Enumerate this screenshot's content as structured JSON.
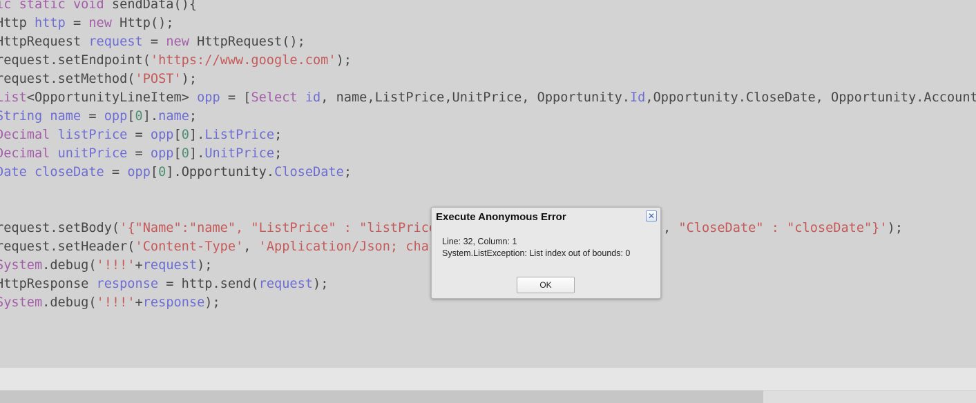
{
  "code_lines": [
    [
      [
        "kw",
        "ic static void"
      ],
      [
        "pl",
        " sendData(){"
      ]
    ],
    [
      [
        "pl",
        "Http "
      ],
      [
        "var",
        "http"
      ],
      [
        "pl",
        " = "
      ],
      [
        "kw",
        "new"
      ],
      [
        "pl",
        " Http();"
      ]
    ],
    [
      [
        "pl",
        "HttpRequest "
      ],
      [
        "var",
        "request"
      ],
      [
        "pl",
        " = "
      ],
      [
        "kw",
        "new"
      ],
      [
        "pl",
        " HttpRequest();"
      ]
    ],
    [
      [
        "pl",
        "request.setEndpoint("
      ],
      [
        "str",
        "'https://www.google.com'"
      ],
      [
        "pl",
        ");"
      ]
    ],
    [
      [
        "pl",
        "request.setMethod("
      ],
      [
        "str",
        "'POST'"
      ],
      [
        "pl",
        ");"
      ]
    ],
    [
      [
        "kw",
        "List"
      ],
      [
        "pl",
        "<OpportunityLineItem> "
      ],
      [
        "var",
        "opp"
      ],
      [
        "pl",
        " = ["
      ],
      [
        "kw",
        "Select"
      ],
      [
        "pl",
        " "
      ],
      [
        "var",
        "id"
      ],
      [
        "pl",
        ", name,ListPrice,UnitPrice, Opportunity."
      ],
      [
        "var",
        "Id"
      ],
      [
        "pl",
        ",Opportunity.CloseDate, Opportunity.Account"
      ]
    ],
    [
      [
        "var",
        "String name"
      ],
      [
        "pl",
        " = "
      ],
      [
        "var",
        "opp"
      ],
      [
        "pl",
        "["
      ],
      [
        "num",
        "0"
      ],
      [
        "pl",
        "]."
      ],
      [
        "var",
        "name"
      ],
      [
        "pl",
        ";"
      ]
    ],
    [
      [
        "kw",
        "Decimal"
      ],
      [
        "pl",
        " "
      ],
      [
        "var",
        "listPrice"
      ],
      [
        "pl",
        " = "
      ],
      [
        "var",
        "opp"
      ],
      [
        "pl",
        "["
      ],
      [
        "num",
        "0"
      ],
      [
        "pl",
        "]."
      ],
      [
        "var",
        "ListPrice"
      ],
      [
        "pl",
        ";"
      ]
    ],
    [
      [
        "kw",
        "Decimal"
      ],
      [
        "pl",
        " "
      ],
      [
        "var",
        "unitPrice"
      ],
      [
        "pl",
        " = "
      ],
      [
        "var",
        "opp"
      ],
      [
        "pl",
        "["
      ],
      [
        "num",
        "0"
      ],
      [
        "pl",
        "]."
      ],
      [
        "var",
        "UnitPrice"
      ],
      [
        "pl",
        ";"
      ]
    ],
    [
      [
        "var",
        "Date closeDate"
      ],
      [
        "pl",
        " = "
      ],
      [
        "var",
        "opp"
      ],
      [
        "pl",
        "["
      ],
      [
        "num",
        "0"
      ],
      [
        "pl",
        "].Opportunity."
      ],
      [
        "var",
        "CloseDate"
      ],
      [
        "pl",
        ";"
      ]
    ],
    [],
    [],
    [
      [
        "pl",
        "request.setBody("
      ],
      [
        "str",
        "'{\"Name\":\"name\", \"ListPrice\" : \"listPrice"
      ]
    ],
    [
      [
        "pl",
        "request.setHeader("
      ],
      [
        "str",
        "'Content-Type'"
      ],
      [
        "pl",
        ", "
      ],
      [
        "str",
        "'Application/Json; char"
      ]
    ],
    [
      [
        "kw",
        "System"
      ],
      [
        "pl",
        ".debug("
      ],
      [
        "str",
        "'!!!'"
      ],
      [
        "pl",
        "+"
      ],
      [
        "var",
        "request"
      ],
      [
        "pl",
        ");"
      ]
    ],
    [
      [
        "pl",
        "HttpResponse "
      ],
      [
        "var",
        "response"
      ],
      [
        "pl",
        " = http.send("
      ],
      [
        "var",
        "request"
      ],
      [
        "pl",
        ");"
      ]
    ],
    [
      [
        "kw",
        "System"
      ],
      [
        "pl",
        ".debug("
      ],
      [
        "str",
        "'!!!'"
      ],
      [
        "pl",
        "+"
      ],
      [
        "var",
        "response"
      ],
      [
        "pl",
        ");"
      ]
    ]
  ],
  "code_line_tail": {
    "index": 12,
    "tokens": [
      [
        "pl",
        ", "
      ],
      [
        "str",
        "\"CloseDate\" : \"closeDate\"}'"
      ],
      [
        "pl",
        ");"
      ]
    ]
  },
  "dialog": {
    "title": "Execute Anonymous Error",
    "close_icon": "close-x-icon",
    "close_glyph": "✕",
    "line1": "Line: 32, Column: 1",
    "line2": "System.ListException: List index out of bounds: 0",
    "ok_label": "OK"
  }
}
